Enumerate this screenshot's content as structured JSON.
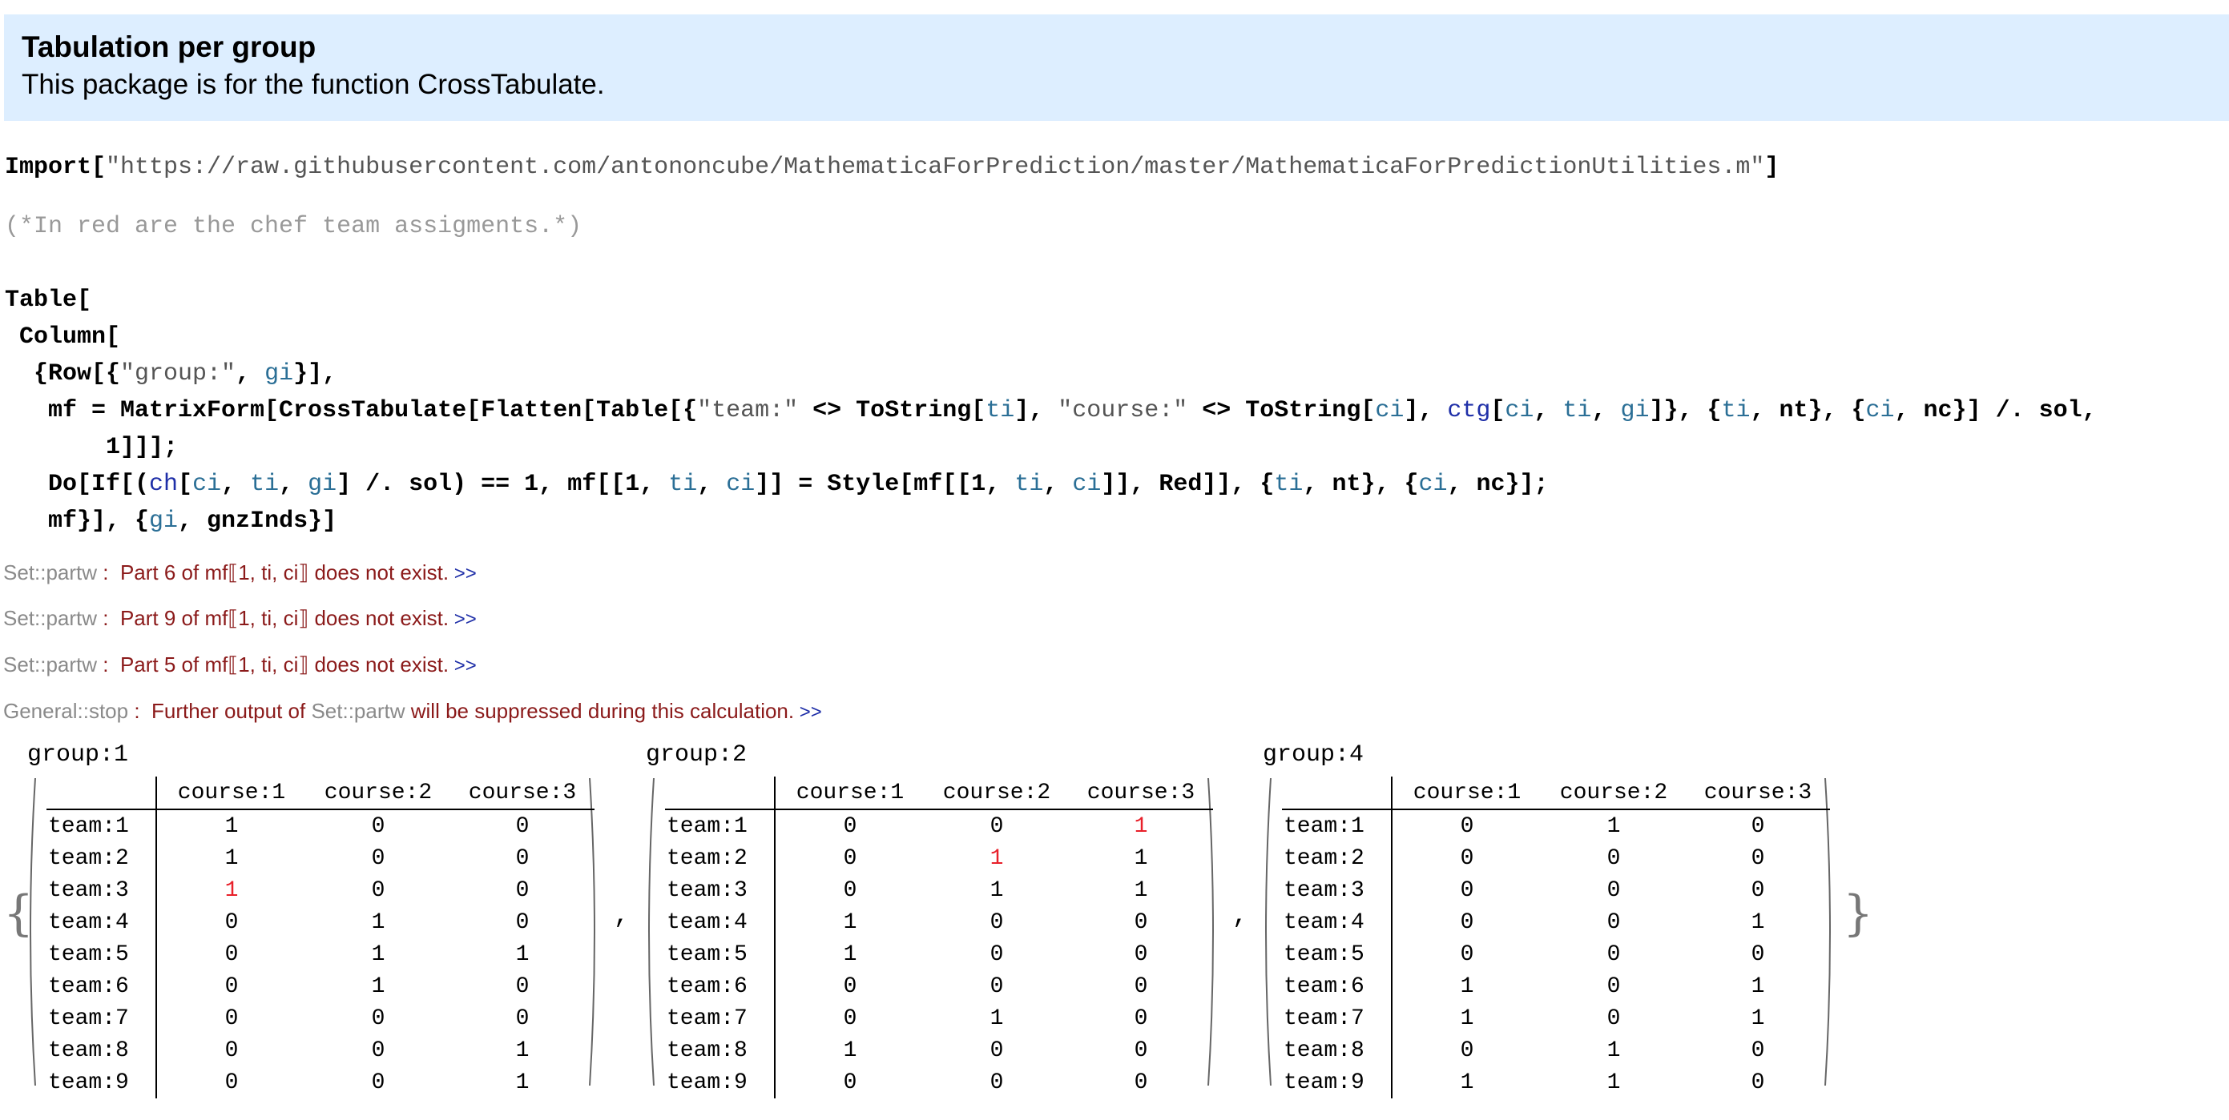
{
  "header": {
    "title": "Tabulation per group",
    "subtitle": "This package is for the function CrossTabulate."
  },
  "code": {
    "import_fn": "Import[",
    "import_url": "\"https://raw.githubusercontent.com/antononcube/MathematicaForPrediction/master/MathematicaForPredictionUtilities.m\"",
    "import_close": "]",
    "comment": "(*In red are the chef team assigments.*)",
    "l1": "Table[",
    "l2": " Column[",
    "l3a": "  {Row[{",
    "l3b": "\"group:\"",
    "l3c": ", ",
    "l3d": "gi",
    "l3e": "}],",
    "l4a": "   mf = MatrixForm[CrossTabulate[Flatten[Table[{",
    "l4b": "\"team:\"",
    "l4c": " <> ToString[",
    "l4d": "ti",
    "l4e": "], ",
    "l4f": "\"course:\"",
    "l4g": " <> ToString[",
    "l4h": "ci",
    "l4i": "], ",
    "l4j": "ctg",
    "l4k": "[",
    "l4l": "ci",
    "l4m": ", ",
    "l4n": "ti",
    "l4o": ", ",
    "l4p": "gi",
    "l4q": "]}, {",
    "l4r": "ti",
    "l4s": ", nt}, {",
    "l4t": "ci",
    "l4u": ", nc}] /. sol,",
    "l5": "       1]]];",
    "l6a": "   Do[If[(",
    "l6b": "ch",
    "l6c": "[",
    "l6d": "ci",
    "l6e": ", ",
    "l6f": "ti",
    "l6g": ", ",
    "l6h": "gi",
    "l6i": "] /. sol) == 1, mf[[1, ",
    "l6j": "ti",
    "l6k": ", ",
    "l6l": "ci",
    "l6m": "]] = Style[mf[[1, ",
    "l6n": "ti",
    "l6o": ", ",
    "l6p": "ci",
    "l6q": "]], Red]], {",
    "l6r": "ti",
    "l6s": ", nt}, {",
    "l6t": "ci",
    "l6u": ", nc}];",
    "l7a": "   mf}], {",
    "l7b": "gi",
    "l7c": ", gnzInds}]"
  },
  "messages": [
    {
      "tag": "Set::partw",
      "sep": " :  ",
      "text": "Part 6 of mf⟦1, ti, ci⟧ does not exist.",
      "more": " >>"
    },
    {
      "tag": "Set::partw",
      "sep": " :  ",
      "text": "Part 9 of mf⟦1, ti, ci⟧ does not exist.",
      "more": " >>"
    },
    {
      "tag": "Set::partw",
      "sep": " :  ",
      "text": "Part 5 of mf⟦1, ti, ci⟧ does not exist.",
      "more": " >>"
    },
    {
      "tag": "General::stop",
      "sep": " :  ",
      "text1": "Further output of ",
      "tag2": "Set::partw",
      "text2": " will be suppressed during this calculation.",
      "more": " >>"
    }
  ],
  "output": {
    "open_brace": "{",
    "close_brace": "}",
    "comma": ",",
    "columns": [
      "course:1",
      "course:2",
      "course:3"
    ],
    "rows": [
      "team:1",
      "team:2",
      "team:3",
      "team:4",
      "team:5",
      "team:6",
      "team:7",
      "team:8",
      "team:9"
    ],
    "groups": [
      {
        "label": "group:1",
        "values": [
          [
            1,
            0,
            0
          ],
          [
            1,
            0,
            0
          ],
          [
            1,
            0,
            0
          ],
          [
            0,
            1,
            0
          ],
          [
            0,
            1,
            1
          ],
          [
            0,
            1,
            0
          ],
          [
            0,
            0,
            0
          ],
          [
            0,
            0,
            1
          ],
          [
            0,
            0,
            1
          ]
        ],
        "red": [
          [
            2,
            0
          ]
        ]
      },
      {
        "label": "group:2",
        "values": [
          [
            0,
            0,
            1
          ],
          [
            0,
            1,
            1
          ],
          [
            0,
            1,
            1
          ],
          [
            1,
            0,
            0
          ],
          [
            1,
            0,
            0
          ],
          [
            0,
            0,
            0
          ],
          [
            0,
            1,
            0
          ],
          [
            1,
            0,
            0
          ],
          [
            0,
            0,
            0
          ]
        ],
        "red": [
          [
            0,
            2
          ],
          [
            1,
            1
          ]
        ]
      },
      {
        "label": "group:4",
        "values": [
          [
            0,
            1,
            0
          ],
          [
            0,
            0,
            0
          ],
          [
            0,
            0,
            0
          ],
          [
            0,
            0,
            1
          ],
          [
            0,
            0,
            0
          ],
          [
            1,
            0,
            1
          ],
          [
            1,
            0,
            1
          ],
          [
            0,
            1,
            0
          ],
          [
            1,
            1,
            0
          ]
        ],
        "red": []
      }
    ]
  },
  "colors": {
    "header_bg": "#ddeeff",
    "highlight_red": "#e8202a",
    "message_red": "#8b1a1a",
    "variable_blue": "#2b6f96"
  }
}
